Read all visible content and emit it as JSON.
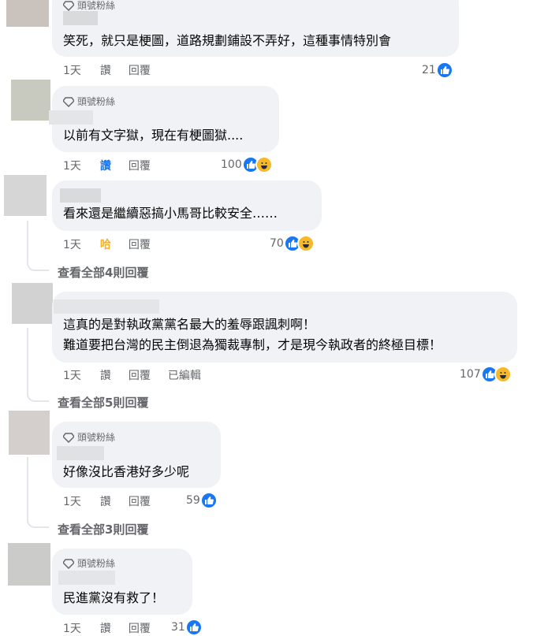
{
  "badge_label": "頭號粉絲",
  "comments": [
    {
      "has_badge": true,
      "text": [
        "笑死，就只是梗圖，道路規劃鋪設不弄好，這種事情特別會"
      ],
      "time": "1天",
      "like": "讚",
      "reply": "回覆",
      "count": "21"
    },
    {
      "has_badge": true,
      "text": [
        "以前有文字獄，現在有梗圖獄...."
      ],
      "time": "1天",
      "like": "讚",
      "reply": "回覆",
      "count": "100"
    },
    {
      "has_badge": false,
      "text": [
        "看來還是繼續惡搞小馬哥比較安全……"
      ],
      "time": "1天",
      "like": "哈",
      "reply": "回覆",
      "count": "70",
      "view_more": "查看全部4則回覆"
    },
    {
      "has_badge": false,
      "text": [
        "這真的是對執政黨黨名最大的羞辱跟諷刺啊！",
        "難道要把台灣的民主倒退為獨裁專制，才是現今執政者的終極目標！"
      ],
      "time": "1天",
      "like": "讚",
      "reply": "回覆",
      "edited": "已編輯",
      "count": "107",
      "view_more": "查看全部5則回覆"
    },
    {
      "has_badge": true,
      "text": [
        "好像沒比香港好多少呢"
      ],
      "time": "1天",
      "like": "讚",
      "reply": "回覆",
      "count": "59",
      "view_more": "查看全部3則回覆"
    },
    {
      "has_badge": true,
      "text": [
        "民進黨沒有救了！"
      ],
      "time": "1天",
      "like": "讚",
      "reply": "回覆",
      "count": "31"
    }
  ]
}
